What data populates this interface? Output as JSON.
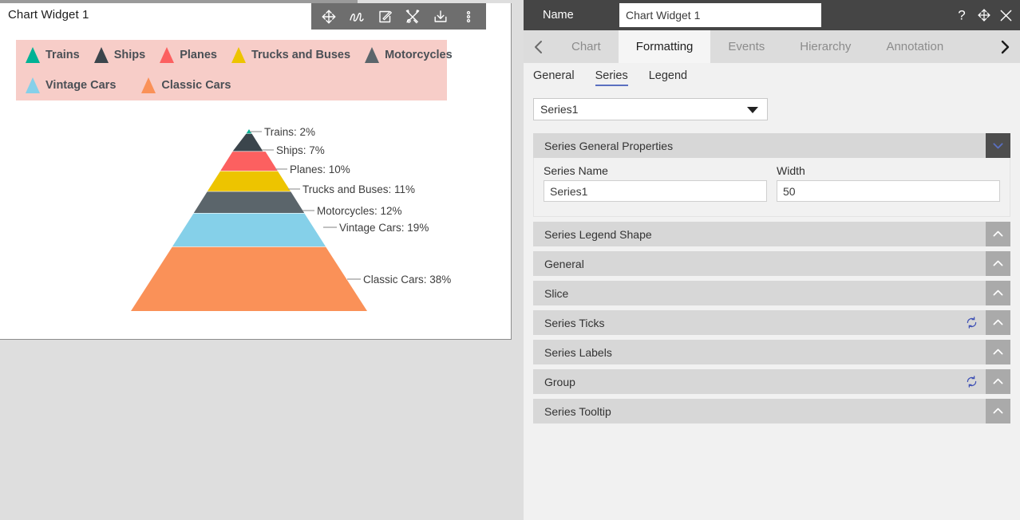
{
  "widget": {
    "title": "Chart Widget 1",
    "toolbar": [
      {
        "name": "move-icon",
        "label": "Move"
      },
      {
        "name": "scribble-icon",
        "label": "Annotate"
      },
      {
        "name": "edit-icon",
        "label": "Edit"
      },
      {
        "name": "tools-icon",
        "label": "Tools"
      },
      {
        "name": "download-icon",
        "label": "Download"
      },
      {
        "name": "more-vertical-icon",
        "label": "More"
      }
    ]
  },
  "chart_data": {
    "type": "pie",
    "subtype": "pyramid",
    "title": "",
    "legend_position": "top",
    "categories": [
      "Trains",
      "Ships",
      "Planes",
      "Trucks and Buses",
      "Motorcycles",
      "Vintage Cars",
      "Classic Cars"
    ],
    "values": [
      2,
      7,
      10,
      11,
      12,
      19,
      38
    ],
    "value_unit": "%",
    "colors": [
      "#00b295",
      "#3b454c",
      "#fc6060",
      "#edc400",
      "#5b656b",
      "#85d0e9",
      "#fa9158"
    ],
    "slice_labels": [
      "Trains: 2%",
      "Ships: 7%",
      "Planes: 10%",
      "Trucks and Buses: 11%",
      "Motorcycles: 12%",
      "Vintage Cars: 19%",
      "Classic Cars: 38%"
    ],
    "legend_background": "#f7cdc8",
    "legend_entries": [
      {
        "label": "Trains",
        "color": "#00b295"
      },
      {
        "label": "Ships",
        "color": "#3b454c"
      },
      {
        "label": "Planes",
        "color": "#fc6060"
      },
      {
        "label": "Trucks and Buses",
        "color": "#edc400"
      },
      {
        "label": "Motorcycles",
        "color": "#5b656b"
      },
      {
        "label": "Vintage Cars",
        "color": "#85d0e9"
      },
      {
        "label": "Classic Cars",
        "color": "#fa9158"
      }
    ]
  },
  "panel": {
    "name_label": "Name",
    "name_value": "Chart Widget 1",
    "header_icons": [
      {
        "name": "help-icon",
        "label": "?"
      },
      {
        "name": "move-panel-icon",
        "label": "Move"
      },
      {
        "name": "close-icon",
        "label": "Close"
      }
    ],
    "tabs": [
      {
        "label": "Chart",
        "active": false
      },
      {
        "label": "Formatting",
        "active": true
      },
      {
        "label": "Events",
        "active": false
      },
      {
        "label": "Hierarchy",
        "active": false
      },
      {
        "label": "Annotation",
        "active": false
      }
    ],
    "subtabs": [
      {
        "label": "General",
        "active": false
      },
      {
        "label": "Series",
        "active": true
      },
      {
        "label": "Legend",
        "active": false
      }
    ],
    "series_select": {
      "value": "Series1"
    },
    "sections": [
      {
        "title": "Series General Properties",
        "expanded": true,
        "refresh": false,
        "fields": [
          {
            "label": "Series Name",
            "value": "Series1"
          },
          {
            "label": "Width",
            "value": "50"
          }
        ]
      },
      {
        "title": "Series Legend Shape",
        "expanded": false,
        "refresh": false
      },
      {
        "title": "General",
        "expanded": false,
        "refresh": false
      },
      {
        "title": "Slice",
        "expanded": false,
        "refresh": false
      },
      {
        "title": "Series Ticks",
        "expanded": false,
        "refresh": true
      },
      {
        "title": "Series Labels",
        "expanded": false,
        "refresh": false
      },
      {
        "title": "Group",
        "expanded": false,
        "refresh": true
      },
      {
        "title": "Series Tooltip",
        "expanded": false,
        "refresh": false
      }
    ]
  },
  "colors": {
    "panel_header_bg": "#454545",
    "accent_blue": "#5a6fc0",
    "toolbar_bg": "#6e6e6e",
    "canvas_bg": "#dedede"
  }
}
